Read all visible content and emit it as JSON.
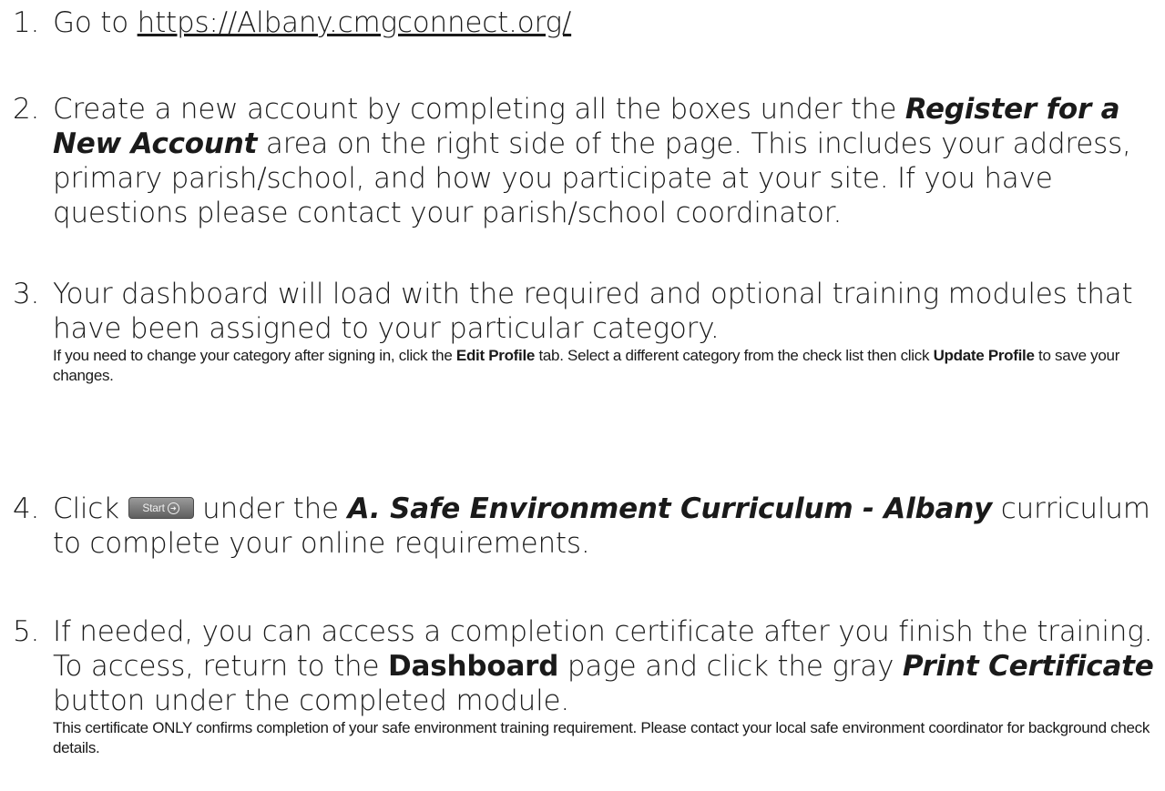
{
  "steps": [
    {
      "num": "1.",
      "prefix": "Go to ",
      "link": "https://Albany.cmgconnect.org/"
    },
    {
      "num": "2.",
      "text_a": "Create a new account by completing all the boxes under the ",
      "bold_a": "Register for a New Account",
      "text_b": " area on the right side of the page. This includes your address, primary parish/school, and how you participate at your site. If you have questions please contact your parish/school coordinator."
    },
    {
      "num": "3.",
      "text_a": "Your dashboard will load with the required and optional training modules that have been assigned to your particular category.",
      "note_a": "If you need to change your category after signing in, click the ",
      "note_bold_a": "Edit Profile",
      "note_b": " tab. Select a different category from the check list then click ",
      "note_bold_b": "Update Profile",
      "note_c": " to save your changes."
    },
    {
      "num": "4.",
      "text_a": "Click ",
      "button_label": "Start",
      "button_icon": "arrow-circle-icon",
      "text_b": " under the ",
      "bold_a": "A. Safe Environment Curriculum - Albany",
      "text_c": " curriculum to complete your online requirements."
    },
    {
      "num": "5.",
      "text_a": "If needed, you can access a completion certificate after you finish the training. To access, return to the ",
      "bold_a": "Dashboard",
      "text_b": " page and click the gray ",
      "bold_b": "Print Certificate",
      "text_c": " button under the completed module.",
      "note_a": "This certificate ONLY confirms completion of your safe environment training requirement. Please contact your local safe environment coordinator for background check details."
    }
  ]
}
